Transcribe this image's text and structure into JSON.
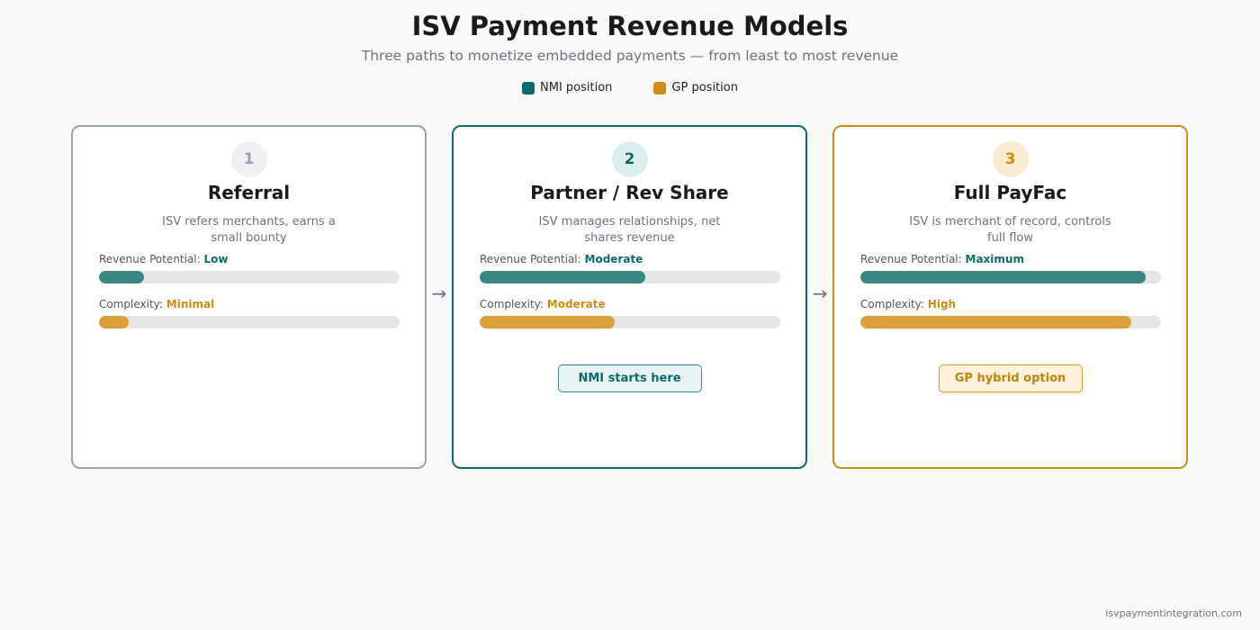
{
  "header": {
    "title": "ISV Payment Revenue Models",
    "subtitle": "Three paths to monetize embedded payments — from least to most revenue"
  },
  "legend": [
    {
      "label": "NMI position",
      "color": "#0f6b6b"
    },
    {
      "label": "GP position",
      "color": "#d08c17"
    }
  ],
  "cards": [
    {
      "number": "1",
      "title": "Referral",
      "description": "ISV refers merchants, earns a small bounty",
      "revenue_label": "Revenue Potential:",
      "revenue_value": "Low",
      "revenue_level": 0.15,
      "complexity_label": "Complexity:",
      "complexity_value": "Minimal",
      "complexity_level": 0.1,
      "callout": ""
    },
    {
      "number": "2",
      "title": "Partner / Rev Share",
      "description": "ISV manages relationships, net shares revenue",
      "revenue_label": "Revenue Potential:",
      "revenue_value": "Moderate",
      "revenue_level": 0.55,
      "complexity_label": "Complexity:",
      "complexity_value": "Moderate",
      "complexity_level": 0.45,
      "callout": "NMI starts here"
    },
    {
      "number": "3",
      "title": "Full PayFac",
      "description": "ISV is merchant of record, controls full flow",
      "revenue_label": "Revenue Potential:",
      "revenue_value": "Maximum",
      "revenue_level": 0.95,
      "complexity_label": "Complexity:",
      "complexity_value": "High",
      "complexity_level": 0.9,
      "callout": "GP hybrid option"
    }
  ],
  "arrows": [
    "→",
    "→"
  ],
  "footer": {
    "site": "isvpaymentintegration.com"
  }
}
